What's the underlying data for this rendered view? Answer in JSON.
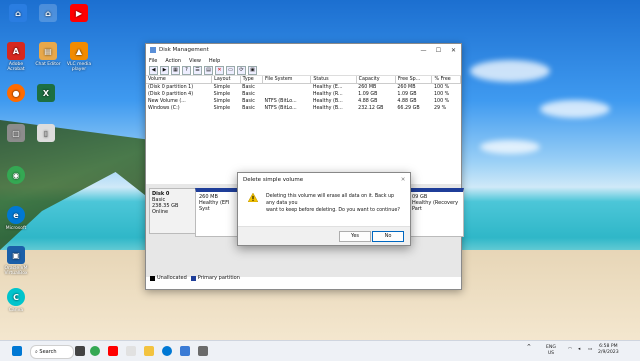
{
  "desktop": {
    "icons": [
      {
        "label": "",
        "color": "#2a7de1",
        "glyph": "⌂"
      },
      {
        "label": "",
        "color": "#ff0000",
        "glyph": "▶"
      },
      {
        "label": "Adobe Acrobat",
        "color": "#d7281f",
        "glyph": "A"
      },
      {
        "label": "Chat Editor",
        "color": "#e8a84a",
        "glyph": "▤"
      },
      {
        "label": "VLC media player",
        "color": "#f28b00",
        "glyph": "▲"
      },
      {
        "label": "",
        "color": "#ff6b00",
        "glyph": "●"
      },
      {
        "label": "",
        "color": "#1d6f42",
        "glyph": "X"
      },
      {
        "label": "",
        "color": "#8c8c8c",
        "glyph": "▢"
      },
      {
        "label": "",
        "color": "#dddddd",
        "glyph": "▯"
      },
      {
        "label": "",
        "color": "#34a853",
        "glyph": "◉"
      },
      {
        "label": "Microsoft",
        "color": "#0078d4",
        "glyph": "e"
      },
      {
        "label": "Oracle VM VirtualBox",
        "color": "#1b5fa8",
        "glyph": "▣"
      },
      {
        "label": "Canva",
        "color": "#00c4cc",
        "glyph": "C"
      }
    ]
  },
  "window": {
    "title": "Disk Management",
    "menu": [
      "File",
      "Action",
      "View",
      "Help"
    ],
    "toolbar_icons": [
      "back-icon",
      "forward-icon",
      "console-icon",
      "help-icon",
      "list-icon",
      "properties-icon",
      "delete-icon",
      "folder-icon",
      "rescan-icon",
      "disk-icon"
    ],
    "columns": [
      "Volume",
      "Layout",
      "Type",
      "File System",
      "Status",
      "Capacity",
      "Free Sp...",
      "% Free"
    ],
    "rows": [
      [
        "(Disk 0 partition 1)",
        "Simple",
        "Basic",
        "",
        "Healthy (E...",
        "260 MB",
        "260 MB",
        "100 %"
      ],
      [
        "(Disk 0 partition 4)",
        "Simple",
        "Basic",
        "",
        "Healthy (R...",
        "1.09 GB",
        "1.09 GB",
        "100 %"
      ],
      [
        "New Volume (...",
        "Simple",
        "Basic",
        "NTFS (BitLo...",
        "Healthy (B...",
        "4.88 GB",
        "4.88 GB",
        "100 %"
      ],
      [
        "Windows (C:)",
        "Simple",
        "Basic",
        "NTFS (BitLo...",
        "Healthy (B...",
        "232.12 GB",
        "66.29 GB",
        "29 %"
      ]
    ],
    "disk": {
      "name": "Disk 0",
      "type": "Basic",
      "size": "238.35 GB",
      "status": "Online",
      "partitions": [
        {
          "size": "260 MB",
          "status": "Healthy (EFI Syst"
        },
        {
          "size": "09 GB",
          "status": "Healthy (Recovery Part"
        }
      ]
    },
    "legend": [
      {
        "label": "Unallocated",
        "color": "#000000"
      },
      {
        "label": "Primary partition",
        "color": "#1f3e99"
      }
    ]
  },
  "dialog": {
    "title": "Delete simple volume",
    "message_line1": "Deleting this volume will erase all data on it. Back up any data you",
    "message_line2": "want to keep before deleting. Do you want to continue?",
    "yes": "Yes",
    "no": "No"
  },
  "taskbar": {
    "search": "Search",
    "lang1": "ENG",
    "lang2": "US",
    "time": "6:58 PM",
    "date": "2/9/2023"
  }
}
